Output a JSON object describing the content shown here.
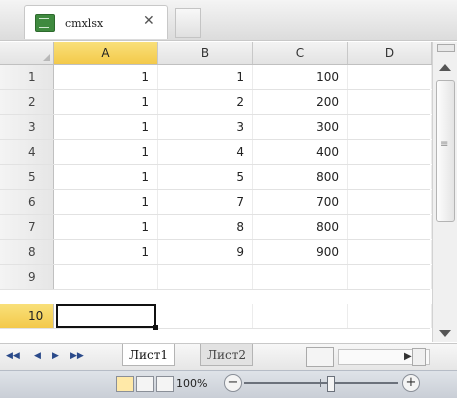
{
  "file_tab": {
    "name": "cmxlsx",
    "close": "✕"
  },
  "columns": [
    "A",
    "B",
    "C",
    "D"
  ],
  "active_column": "A",
  "rows": [
    {
      "num": "1",
      "a": "1",
      "b": "1",
      "c": "100"
    },
    {
      "num": "2",
      "a": "1",
      "b": "2",
      "c": "200"
    },
    {
      "num": "3",
      "a": "1",
      "b": "3",
      "c": "300"
    },
    {
      "num": "4",
      "a": "1",
      "b": "4",
      "c": "400"
    },
    {
      "num": "5",
      "a": "1",
      "b": "5",
      "c": "800"
    },
    {
      "num": "6",
      "a": "1",
      "b": "7",
      "c": "700"
    },
    {
      "num": "7",
      "a": "1",
      "b": "8",
      "c": "800"
    },
    {
      "num": "8",
      "a": "1",
      "b": "9",
      "c": "900"
    },
    {
      "num": "9",
      "a": "",
      "b": "",
      "c": ""
    },
    {
      "num": "10",
      "a": "",
      "b": "",
      "c": ""
    }
  ],
  "active_row": "9",
  "sheets": {
    "nav": [
      "◀◀",
      "◀",
      "▶",
      "▶▶"
    ],
    "tabs": [
      "Лист1",
      "Лист2"
    ],
    "active": "Лист1"
  },
  "status": {
    "zoom": "100%",
    "minus": "−",
    "plus": "+"
  },
  "icons": {
    "file": "spreadsheet-file-icon",
    "close": "close-icon",
    "scroll_up": "arrow-up-icon",
    "scroll_down": "arrow-down-icon"
  },
  "colors": {
    "selection": "#f3c94a",
    "accent": "#3f8a3f"
  }
}
